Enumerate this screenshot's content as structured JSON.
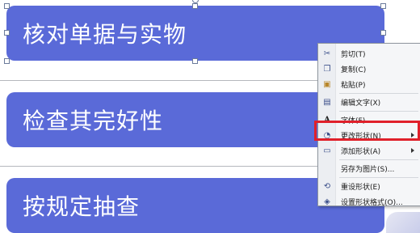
{
  "slide": {
    "shapes": [
      {
        "text": "核对单据与实物"
      },
      {
        "text": "检查其完好性"
      },
      {
        "text": "按规定抽查"
      }
    ]
  },
  "context_menu": {
    "items": [
      {
        "label": "剪切(T)",
        "icon": "scissors-icon"
      },
      {
        "label": "复制(C)",
        "icon": "copy-icon"
      },
      {
        "label": "粘贴(P)",
        "icon": "paste-icon"
      },
      {
        "label": "编辑文字(X)",
        "icon": "edit-text-icon"
      },
      {
        "label": "字体(F)...",
        "icon": "font-icon"
      },
      {
        "label": "更改形状(N)",
        "icon": "change-shape-icon",
        "submenu": true
      },
      {
        "label": "添加形状(A)",
        "icon": "add-shape-icon",
        "submenu": true
      },
      {
        "label": "另存为图片(S)...",
        "icon": ""
      },
      {
        "label": "重设形状(E)",
        "icon": "reset-shape-icon"
      },
      {
        "label": "设置形状格式(O)...",
        "icon": "format-shape-icon"
      }
    ],
    "highlighted_item": "更改形状(N)",
    "highlight_color": "#e0202a"
  },
  "colors": {
    "shape_fill": "#5a6ad8",
    "shape_text": "#ffffff"
  }
}
